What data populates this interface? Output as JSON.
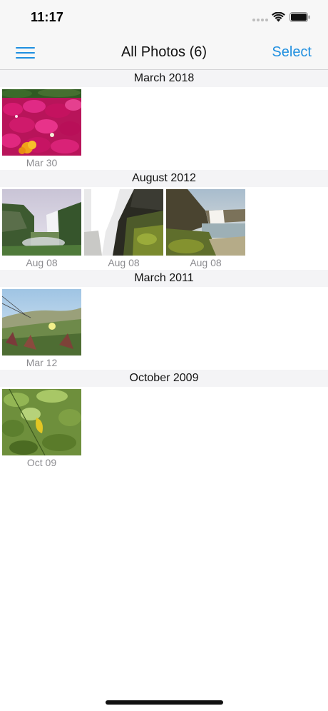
{
  "status_bar": {
    "time": "11:17"
  },
  "nav": {
    "menu_icon": "hamburger-menu-icon",
    "title": "All Photos (6)",
    "select_label": "Select"
  },
  "accent_color": "#1f8fe0",
  "sections": [
    {
      "title": "March 2018",
      "photos": [
        {
          "date": "Mar 30",
          "subject": "flowers"
        }
      ]
    },
    {
      "title": "August 2012",
      "photos": [
        {
          "date": "Aug 08",
          "subject": "waterfall"
        },
        {
          "date": "Aug 08",
          "subject": "waterfall"
        },
        {
          "date": "Aug 08",
          "subject": "waterfall"
        }
      ]
    },
    {
      "title": "March 2011",
      "photos": [
        {
          "date": "Mar 12",
          "subject": "dunes"
        }
      ]
    },
    {
      "title": "October 2009",
      "photos": [
        {
          "date": "Oct 09",
          "subject": "leaves"
        }
      ]
    }
  ]
}
